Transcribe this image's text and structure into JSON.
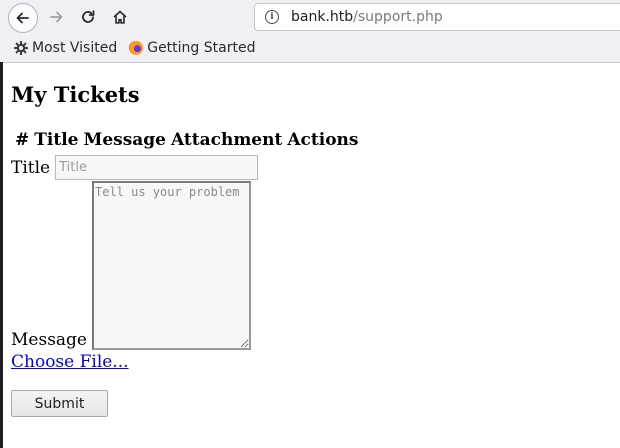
{
  "browser": {
    "url_host": "bank.htb",
    "url_path": "/support.php",
    "bookmarks": [
      {
        "label": "Most Visited",
        "icon": "gear-icon"
      },
      {
        "label": "Getting Started",
        "icon": "firefox-icon"
      }
    ]
  },
  "page": {
    "title": "My Tickets",
    "table_headers": [
      "#",
      "Title",
      "Message",
      "Attachment",
      "Actions"
    ]
  },
  "form": {
    "title_label": "Title",
    "title_placeholder": "Title",
    "message_label": "Message",
    "message_placeholder": "Tell us your problem",
    "file_link_label": "Choose File...",
    "submit_label": "Submit"
  },
  "colors": {
    "link": "#0000ee",
    "chrome_background": "#f0f0f4"
  }
}
